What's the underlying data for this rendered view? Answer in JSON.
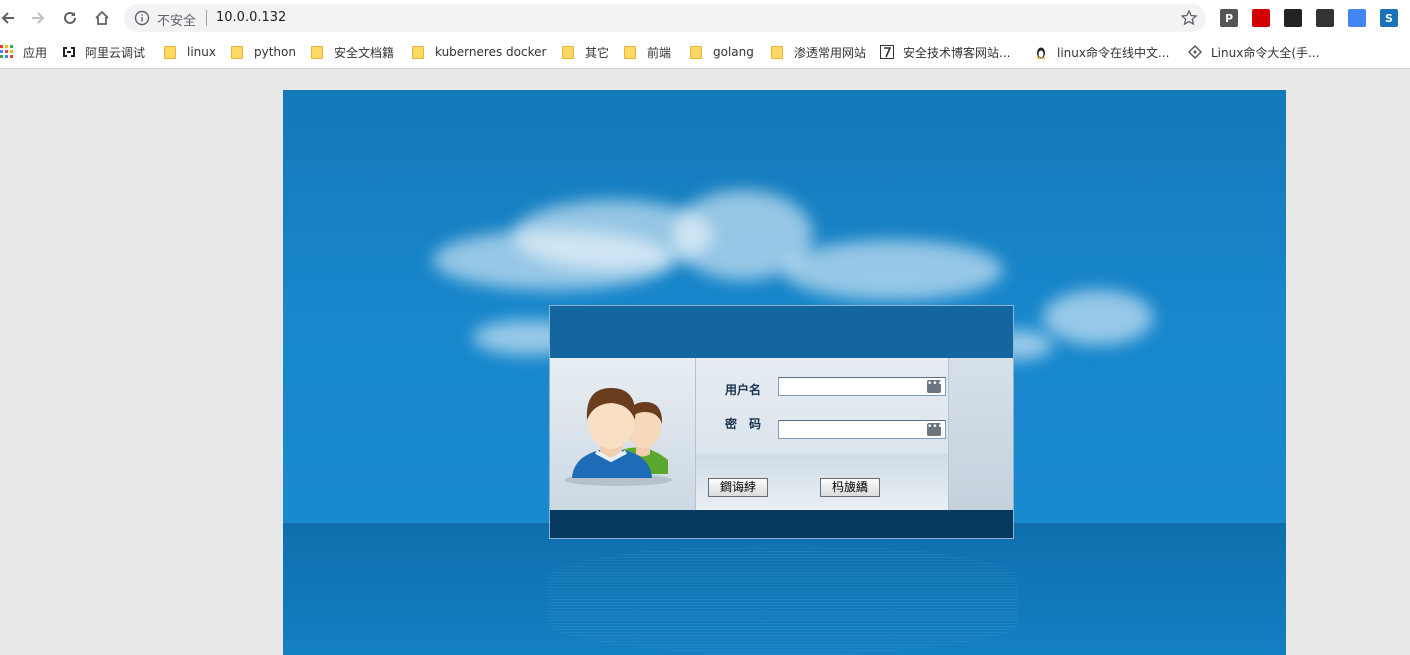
{
  "browser": {
    "insecure_label": "不安全",
    "url": "10.0.0.132"
  },
  "bookmarks": [
    {
      "label": "应用",
      "icon": "apps-grid-icon"
    },
    {
      "label": "阿里云调试",
      "icon": "aliyun-icon"
    },
    {
      "label": "linux",
      "icon": "folder-icon"
    },
    {
      "label": "python",
      "icon": "folder-icon"
    },
    {
      "label": "安全文档籍",
      "icon": "folder-icon"
    },
    {
      "label": "kuberneres docker",
      "icon": "folder-icon"
    },
    {
      "label": "其它",
      "icon": "folder-icon"
    },
    {
      "label": "前端",
      "icon": "folder-icon"
    },
    {
      "label": "golang",
      "icon": "folder-icon"
    },
    {
      "label": "渗透常用网站",
      "icon": "folder-icon"
    },
    {
      "label": "安全技术博客网站...",
      "icon": "seven-icon"
    },
    {
      "label": "linux命令在线中文...",
      "icon": "tux-icon"
    },
    {
      "label": "Linux命令大全(手...",
      "icon": "diamond-icon"
    }
  ],
  "extensions": [
    {
      "icon": "p-extension-icon",
      "text": "P",
      "color": "#555555"
    },
    {
      "icon": "adblock-icon",
      "text": "",
      "color": "#d40000"
    },
    {
      "icon": "ghost-extension-icon",
      "text": "",
      "color": "#222222"
    },
    {
      "icon": "signal-extension-icon",
      "text": "",
      "color": "#333333"
    },
    {
      "icon": "chrome-extension-icon",
      "text": "",
      "color": "#4285f4"
    },
    {
      "icon": "s-extension-icon",
      "text": "S",
      "color": "#1a73b8"
    }
  ],
  "login": {
    "username_label": "用户名",
    "password_label": "密　码",
    "username_value": "",
    "password_value": "",
    "login_button": "鐧诲綍",
    "reset_button": "杩旇繑"
  }
}
